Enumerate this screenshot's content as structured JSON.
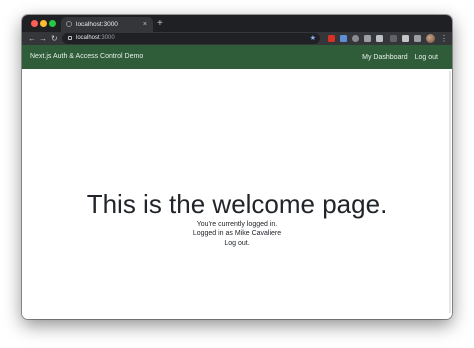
{
  "browser": {
    "tab_title": "localhost:3000",
    "tab_close": "×",
    "new_tab": "+",
    "url_host": "localhost",
    "url_port": ":3000",
    "icons": {
      "back": "←",
      "forward": "→",
      "reload": "↻",
      "home": "⌂",
      "star": "★",
      "menu": "⋮"
    }
  },
  "app_nav": {
    "brand": "Next.js Auth & Access Control Demo",
    "links": [
      "My Dashboard",
      "Log out"
    ]
  },
  "main": {
    "heading": "This is the welcome page.",
    "status": "You're currently logged in.",
    "user_line": "Logged in as Mike Cavaliere",
    "logout_link": "Log out."
  },
  "colors": {
    "navbar": "#2f5d3a",
    "titlebar": "#1f2023",
    "toolbar": "#35363a"
  }
}
